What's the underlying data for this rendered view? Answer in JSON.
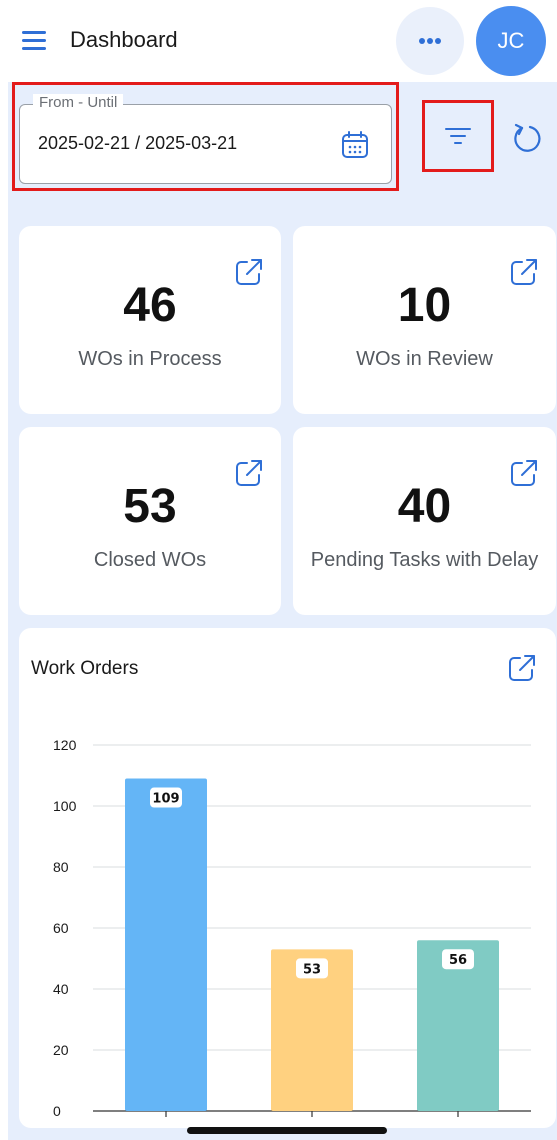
{
  "header": {
    "title": "Dashboard",
    "avatar_initials": "JC",
    "more_label": "•••"
  },
  "date_filter": {
    "legend": "From - Until",
    "value": "2025-02-21 / 2025-03-21"
  },
  "kpis": [
    {
      "value": "46",
      "label": "WOs in Process"
    },
    {
      "value": "10",
      "label": "WOs in Review"
    },
    {
      "value": "53",
      "label": "Closed WOs"
    },
    {
      "value": "40",
      "label": "Pending Tasks with Delay"
    }
  ],
  "colors": {
    "accent": "#4a8ef0",
    "highlight": "#e31b1b",
    "background": "#e6eefc"
  },
  "chart_data": {
    "type": "bar",
    "title": "Work Orders",
    "categories": [
      "",
      "",
      ""
    ],
    "values": [
      109,
      53,
      56
    ],
    "colors": [
      "#64b5f6",
      "#ffd180",
      "#80cbc4"
    ],
    "ylim": [
      0,
      120
    ],
    "yticks": [
      0,
      20,
      40,
      60,
      80,
      100,
      120
    ],
    "grid": true
  }
}
